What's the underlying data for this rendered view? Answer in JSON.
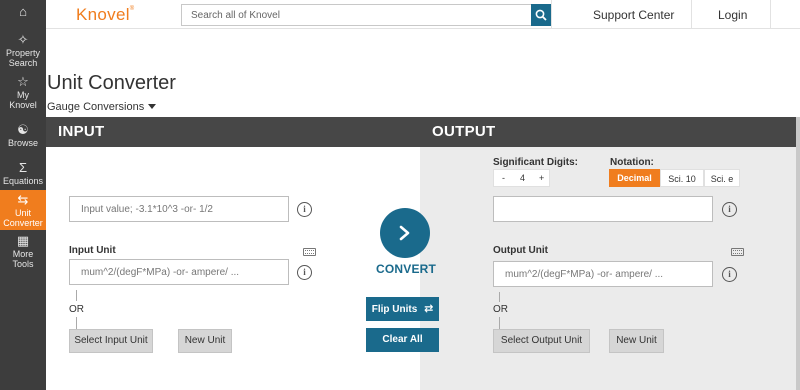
{
  "sidebar": {
    "items": [
      {
        "label": "",
        "icon": "home-icon"
      },
      {
        "label": "Property Search",
        "line1": "Property",
        "line2": "Search",
        "icon": "network-icon"
      },
      {
        "label": "My Knovel",
        "line1": "My",
        "line2": "Knovel",
        "icon": "star-icon"
      },
      {
        "label": "Browse",
        "line1": "Browse",
        "line2": "",
        "icon": "browse-icon"
      },
      {
        "label": "Equations",
        "line1": "Equations",
        "line2": "",
        "icon": "sigma-icon"
      },
      {
        "label": "Unit Converter",
        "line1": "Unit",
        "line2": "Converter",
        "icon": "swap-icon"
      },
      {
        "label": "More Tools",
        "line1": "More",
        "line2": "Tools",
        "icon": "grid-icon"
      }
    ]
  },
  "header": {
    "logo": "Knovel",
    "logo_mark": "®",
    "search_placeholder": "Search all of Knovel",
    "support": "Support Center",
    "login": "Login"
  },
  "page": {
    "title": "Unit Converter",
    "gauge": "Gauge Conversions"
  },
  "input": {
    "heading": "INPUT",
    "value_placeholder": "Input value; -3.1*10^3 -or- 1/2",
    "unit_label": "Input Unit",
    "unit_placeholder": "mum^2/(degF*MPa) -or- ampere/ ...",
    "or": "OR",
    "select_btn": "Select Input Unit",
    "new_btn": "New Unit"
  },
  "middle": {
    "convert": "CONVERT",
    "flip": "Flip Units",
    "clear": "Clear All"
  },
  "output": {
    "heading": "OUTPUT",
    "sig_label": "Significant Digits:",
    "sig_minus": "-",
    "sig_value": "4",
    "sig_plus": "+",
    "notation_label": "Notation:",
    "notation_options": [
      "Decimal",
      "Sci. 10",
      "Sci. e"
    ],
    "notation_selected": "Decimal",
    "value": "",
    "unit_label": "Output Unit",
    "unit_placeholder": "mum^2/(degF*MPa) -or- ampere/ ...",
    "or": "OR",
    "select_btn": "Select Output Unit",
    "new_btn": "New Unit"
  },
  "colors": {
    "accent": "#f07d1e",
    "primary": "#1a6a8c",
    "sidebar": "#3d3d3d",
    "panel_header": "#474747"
  }
}
